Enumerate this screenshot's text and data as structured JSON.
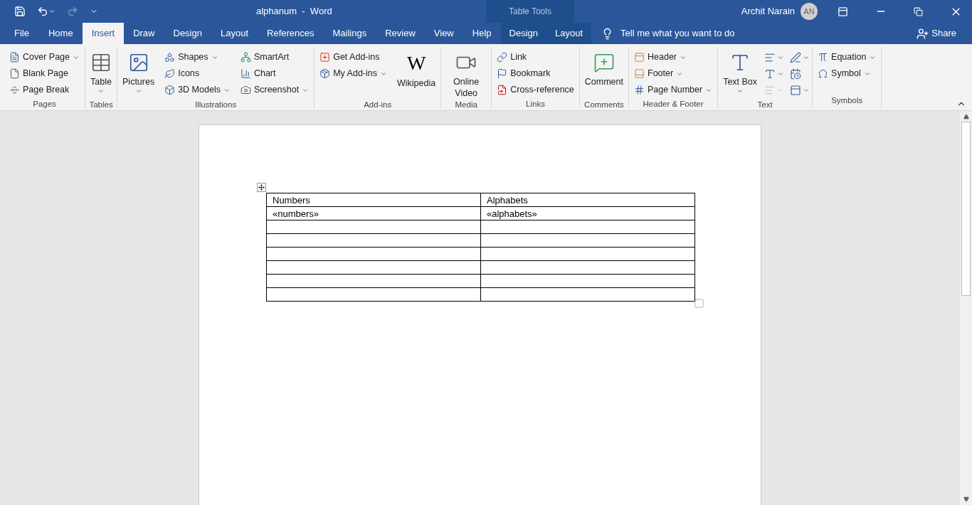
{
  "title_bar": {
    "document": "alphanum  -  Word",
    "context_label": "Table Tools",
    "user": "Archit Narain",
    "avatar_initials": "AN"
  },
  "tabs": [
    {
      "label": "File",
      "kind": "file",
      "selected": false
    },
    {
      "label": "Home",
      "kind": "normal",
      "selected": false
    },
    {
      "label": "Insert",
      "kind": "normal",
      "selected": true
    },
    {
      "label": "Draw",
      "kind": "normal",
      "selected": false
    },
    {
      "label": "Design",
      "kind": "normal",
      "selected": false
    },
    {
      "label": "Layout",
      "kind": "normal",
      "selected": false
    },
    {
      "label": "References",
      "kind": "normal",
      "selected": false
    },
    {
      "label": "Mailings",
      "kind": "normal",
      "selected": false
    },
    {
      "label": "Review",
      "kind": "normal",
      "selected": false
    },
    {
      "label": "View",
      "kind": "normal",
      "selected": false
    },
    {
      "label": "Help",
      "kind": "normal",
      "selected": false
    },
    {
      "label": "Design",
      "kind": "contextual",
      "selected": false
    },
    {
      "label": "Layout",
      "kind": "contextual",
      "selected": false
    }
  ],
  "tell_me": {
    "placeholder": "Tell me what you want to do"
  },
  "share": "Share",
  "ribbon_groups": [
    {
      "name": "Pages",
      "columns": [
        [
          {
            "label": "Cover Page",
            "kind": "small",
            "dropdown": true
          },
          {
            "label": "Blank Page",
            "kind": "small",
            "dropdown": false
          },
          {
            "label": "Page Break",
            "kind": "small",
            "dropdown": false
          }
        ]
      ]
    },
    {
      "name": "Tables",
      "columns": [
        [
          {
            "label": "Table",
            "kind": "large",
            "dropdown": true
          }
        ]
      ]
    },
    {
      "name": "Illustrations",
      "columns": [
        [
          {
            "label": "Pictures",
            "kind": "large",
            "dropdown": true
          }
        ],
        [
          {
            "label": "Shapes",
            "kind": "small",
            "dropdown": true
          },
          {
            "label": "Icons",
            "kind": "small",
            "dropdown": false
          },
          {
            "label": "3D Models",
            "kind": "small",
            "dropdown": true
          }
        ],
        [
          {
            "label": "SmartArt",
            "kind": "small",
            "dropdown": false
          },
          {
            "label": "Chart",
            "kind": "small",
            "dropdown": false
          },
          {
            "label": "Screenshot",
            "kind": "small",
            "dropdown": true
          }
        ]
      ]
    },
    {
      "name": "Add-ins",
      "columns": [
        [
          {
            "label": "Get Add-ins",
            "kind": "small",
            "dropdown": false
          },
          {
            "label": "My Add-ins",
            "kind": "small",
            "dropdown": true
          }
        ],
        [
          {
            "label": "Wikipedia",
            "kind": "large",
            "dropdown": false,
            "glyph": "W"
          }
        ]
      ]
    },
    {
      "name": "Media",
      "columns": [
        [
          {
            "label": "Online Video",
            "kind": "large",
            "dropdown": false
          }
        ]
      ]
    },
    {
      "name": "Links",
      "columns": [
        [
          {
            "label": "Link",
            "kind": "small",
            "dropdown": false
          },
          {
            "label": "Bookmark",
            "kind": "small",
            "dropdown": false
          },
          {
            "label": "Cross-reference",
            "kind": "small",
            "dropdown": false
          }
        ]
      ]
    },
    {
      "name": "Comments",
      "columns": [
        [
          {
            "label": "Comment",
            "kind": "large",
            "dropdown": false
          }
        ]
      ]
    },
    {
      "name": "Header & Footer",
      "columns": [
        [
          {
            "label": "Header",
            "kind": "small",
            "dropdown": true
          },
          {
            "label": "Footer",
            "kind": "small",
            "dropdown": true
          },
          {
            "label": "Page Number",
            "kind": "small",
            "dropdown": true
          }
        ]
      ]
    },
    {
      "name": "Text",
      "columns": [
        [
          {
            "label": "Text Box",
            "kind": "large",
            "dropdown": true
          }
        ],
        [
          {
            "kind": "icons"
          }
        ]
      ]
    },
    {
      "name": "Symbols",
      "columns": [
        [
          {
            "label": "Equation",
            "kind": "small",
            "dropdown": true
          },
          {
            "label": "Symbol",
            "kind": "small",
            "dropdown": true
          }
        ]
      ]
    }
  ],
  "table": {
    "columns": [
      "Numbers",
      "Alphabets"
    ],
    "rows": [
      [
        "«numbers»",
        "«alphabets»"
      ]
    ]
  }
}
